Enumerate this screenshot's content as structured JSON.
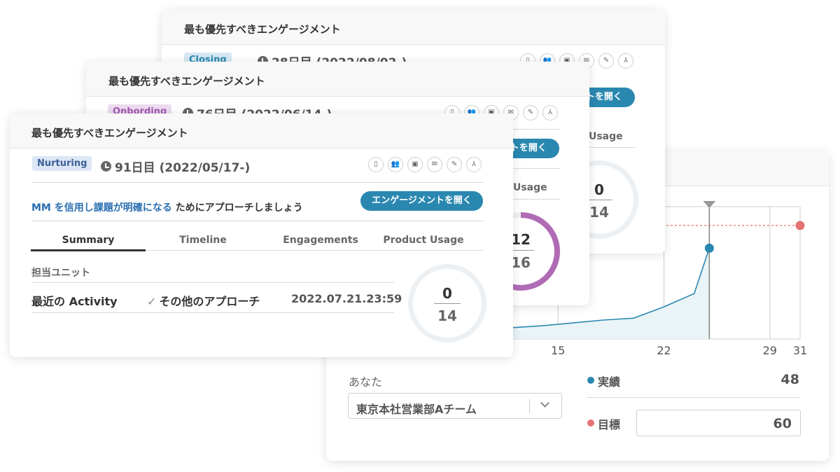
{
  "card_back": {
    "title": "最も優先すべきエンゲージメント",
    "badge": "Closing",
    "date": "28日目 (2022/08/02-)",
    "button": "エンゲージメントを開く",
    "tab_product_usage": "Product Usage",
    "ring": {
      "top": "0",
      "bottom": "14"
    }
  },
  "card_mid": {
    "title": "最も優先すべきエンゲージメント",
    "badge": "Onbording",
    "date": "76日目 (2022/06/14-)",
    "button": "エンゲージメントを開く",
    "tab_product_usage": "Product Usage",
    "ring": {
      "top": "12",
      "bottom": "16"
    }
  },
  "card_front": {
    "title": "最も優先すべきエンゲージメント",
    "badge": "Nurturing",
    "date": "91日目 (2022/05/17-)",
    "goal_link": "MM を信用し課題が明確になる",
    "goal_rest": "ためにアプローチしましょう",
    "button": "エンゲージメントを開く",
    "tabs": [
      "Summary",
      "Timeline",
      "Engagements",
      "Product Usage"
    ],
    "unit_label": "担当ユニット",
    "activity_label": "最近の Activity",
    "activity_value": "その他のアプローチ",
    "activity_time": "2022.07.21.23:59",
    "ring": {
      "top": "0",
      "bottom": "14"
    }
  },
  "icons": [
    "building-icon",
    "people-icon",
    "briefcase-icon",
    "mail-icon",
    "pencil-icon",
    "share-icon"
  ],
  "chart_panel": {
    "you_label": "あなた",
    "team_select": "東京本社営業部Aチーム",
    "actual_label": "実績",
    "actual_value": "48",
    "target_label": "目標",
    "target_value": "60"
  },
  "chart_data": {
    "type": "area",
    "x_ticks": [
      "15",
      "22",
      "29",
      "31"
    ],
    "xlim": [
      8,
      31
    ],
    "ylim": [
      0,
      70
    ],
    "series": [
      {
        "name": "実績",
        "x": [
          8,
          10,
          12,
          14,
          16,
          18,
          20,
          21,
          22,
          24,
          25
        ],
        "values": [
          5,
          5.2,
          6,
          7,
          8.5,
          10,
          11,
          14,
          17,
          24,
          48
        ]
      },
      {
        "name": "目標",
        "x": [
          8,
          31
        ],
        "values": [
          60,
          60
        ]
      }
    ],
    "marker_x": 25,
    "colors": {
      "actual": "#2a88b0",
      "target": "#e57373",
      "area": "#eaf4f7",
      "grid": "#cccccc"
    }
  }
}
